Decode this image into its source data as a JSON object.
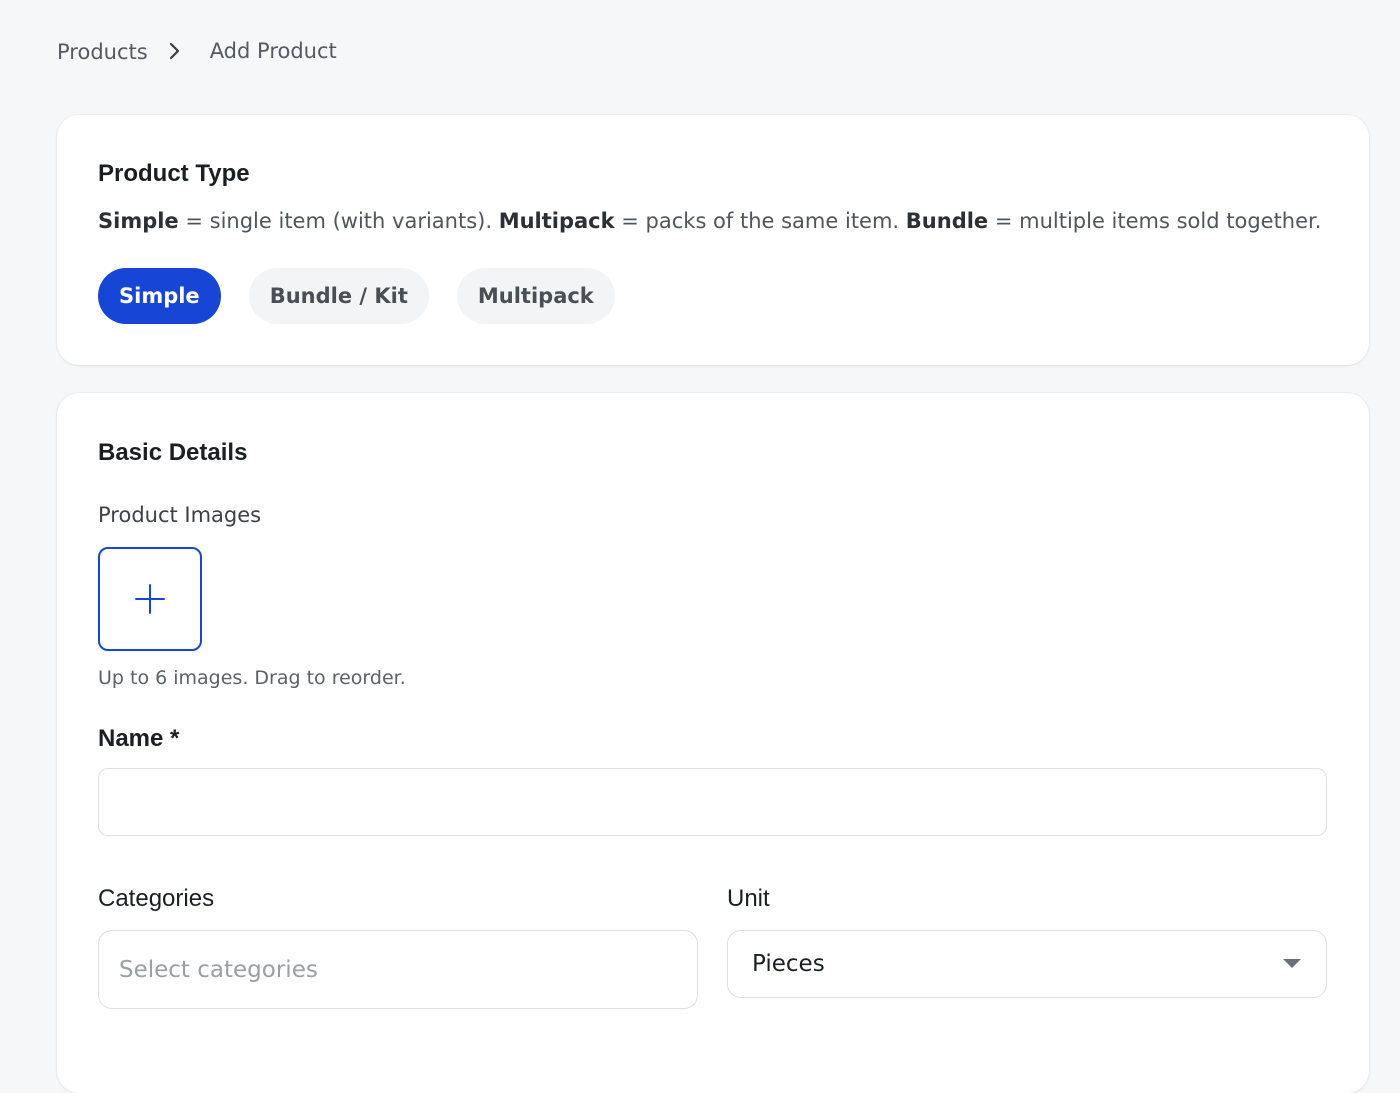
{
  "breadcrumb": {
    "parent": "Products",
    "current": "Add Product",
    "separator_icon": "chevron-right-icon"
  },
  "product_type": {
    "title": "Product Type",
    "description": {
      "simple_term": "Simple",
      "simple_text": " = single item (with variants). ",
      "multipack_term": "Multipack",
      "multipack_text": " = packs of the same item. ",
      "bundle_term": "Bundle",
      "bundle_text": " = multiple items sold together."
    },
    "options": [
      {
        "label": "Simple",
        "selected": true
      },
      {
        "label": "Bundle / Kit",
        "selected": false
      },
      {
        "label": "Multipack",
        "selected": false
      }
    ]
  },
  "basic_details": {
    "title": "Basic Details",
    "images": {
      "label": "Product Images",
      "add_icon": "plus-icon",
      "hint": "Up to 6 images. Drag to reorder."
    },
    "name": {
      "label": "Name *",
      "value": ""
    },
    "categories": {
      "label": "Categories",
      "placeholder": "Select categories"
    },
    "unit": {
      "label": "Unit",
      "value": "Pieces",
      "caret_icon": "caret-down-icon"
    }
  },
  "colors": {
    "accent": "#1746d6",
    "background": "#f6f7f9",
    "card": "#ffffff"
  }
}
